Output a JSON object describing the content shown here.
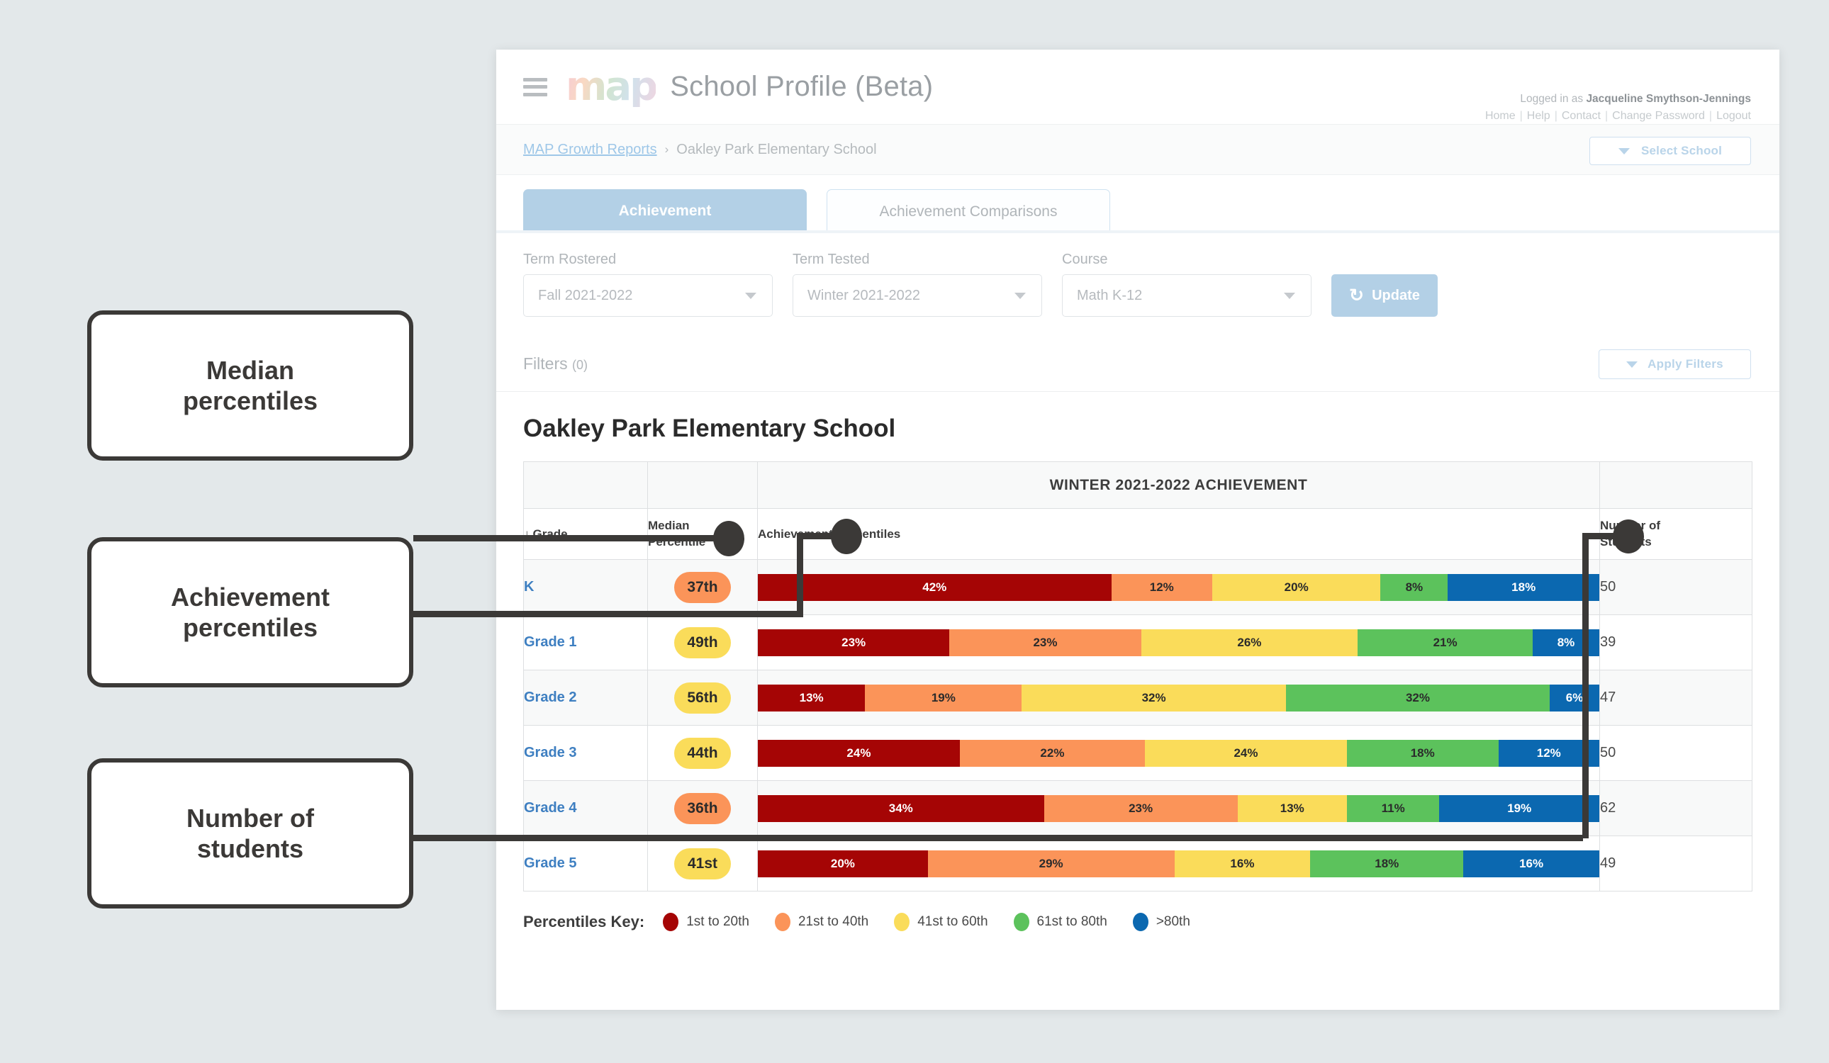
{
  "header": {
    "title": "School Profile (Beta)",
    "logo_text": "map",
    "menu_icon": "hamburger-menu-icon",
    "logged_in_prefix": "Logged in as ",
    "user_name": "Jacqueline Smythson-Jennings",
    "links": [
      "Home",
      "Help",
      "Contact",
      "Change Password",
      "Logout"
    ],
    "link_separator": "|"
  },
  "breadcrumb": {
    "root": "MAP Growth Reports",
    "chevron": "›",
    "current": "Oakley Park Elementary School",
    "select_school_label": "Select School"
  },
  "tabs": [
    {
      "label": "Achievement",
      "active": true
    },
    {
      "label": "Achievement Comparisons",
      "active": false
    }
  ],
  "controls": {
    "term_rostered": {
      "label": "Term Rostered",
      "value": "Fall 2021-2022"
    },
    "term_tested": {
      "label": "Term Tested",
      "value": "Winter 2021-2022"
    },
    "course": {
      "label": "Course",
      "value": "Math K-12"
    },
    "update_label": "Update",
    "update_icon": "refresh-icon"
  },
  "filters": {
    "label": "Filters",
    "count": "(0)",
    "apply_label": "Apply Filters"
  },
  "school_name": "Oakley Park Elementary School",
  "table": {
    "group_header": "WINTER 2021-2022 ACHIEVEMENT",
    "columns": {
      "grade": "Grade",
      "grade_sort_icon": "↓",
      "median_percentile": "Median\nPercentile",
      "median_percentile_line1": "Median",
      "median_percentile_line2": "Percentile",
      "achievement_percentiles": "Achievement Percentiles",
      "number_of_students_line1": "Number of",
      "number_of_students_line2": "Students"
    }
  },
  "legend": {
    "title": "Percentiles Key:",
    "items": [
      {
        "label": "1st to 20th",
        "color": "#A50505"
      },
      {
        "label": "21st to 40th",
        "color": "#FB9459"
      },
      {
        "label": "41st to 60th",
        "color": "#FADC5A"
      },
      {
        "label": "61st to 80th",
        "color": "#5CC25C"
      },
      {
        "label": ">80th",
        "color": "#0B68B0"
      }
    ]
  },
  "callouts": [
    {
      "id": "median",
      "line1": "Median",
      "line2": "percentiles"
    },
    {
      "id": "achiev",
      "line1": "Achievement",
      "line2": "percentiles"
    },
    {
      "id": "nstud",
      "line1": "Number of",
      "line2": "students"
    }
  ],
  "colors": {
    "band1": "#A50505",
    "band2": "#FB9459",
    "band3": "#FADC5A",
    "band4": "#5CC25C",
    "band5": "#0B68B0",
    "pill_orange": "#FB9459",
    "pill_yellow": "#FADC5A",
    "accent_blue": "#B3D0E6",
    "link_blue": "#3E7FC1"
  },
  "chart_data": {
    "type": "bar",
    "title": "WINTER 2021-2022 ACHIEVEMENT",
    "subtitle": "Oakley Park Elementary School",
    "xlabel": "Achievement Percentiles",
    "ylabel": "Grade",
    "stacked": true,
    "percent_total": 100,
    "legend_position": "bottom",
    "grid": false,
    "categories": [
      "K",
      "Grade 1",
      "Grade 2",
      "Grade 3",
      "Grade 4",
      "Grade 5"
    ],
    "series": [
      {
        "name": "1st to 20th",
        "color": "#A50505",
        "values": [
          42,
          23,
          13,
          24,
          34,
          20
        ]
      },
      {
        "name": "21st to 40th",
        "color": "#FB9459",
        "values": [
          12,
          23,
          19,
          22,
          23,
          29
        ]
      },
      {
        "name": "41st to 60th",
        "color": "#FADC5A",
        "values": [
          20,
          26,
          32,
          24,
          13,
          16
        ]
      },
      {
        "name": "61st to 80th",
        "color": "#5CC25C",
        "values": [
          8,
          21,
          32,
          18,
          11,
          18
        ]
      },
      {
        "name": ">80th",
        "color": "#0B68B0",
        "values": [
          18,
          8,
          6,
          12,
          19,
          16
        ]
      }
    ],
    "median_percentiles": [
      "37th",
      "49th",
      "56th",
      "44th",
      "36th",
      "41st"
    ],
    "median_percentile_values": [
      37,
      49,
      56,
      44,
      36,
      41
    ],
    "number_of_students": [
      50,
      39,
      47,
      50,
      62,
      49
    ]
  },
  "rows": [
    {
      "grade": "K",
      "median": "37th",
      "median_color": "#FB9459",
      "students": "50",
      "segments": [
        {
          "label": "42%",
          "value": 42,
          "color": "#A50505",
          "text": "#ffffff"
        },
        {
          "label": "12%",
          "value": 12,
          "color": "#FB9459",
          "text": "#2b2b2b"
        },
        {
          "label": "20%",
          "value": 20,
          "color": "#FADC5A",
          "text": "#2b2b2b"
        },
        {
          "label": "8%",
          "value": 8,
          "color": "#5CC25C",
          "text": "#2b2b2b"
        },
        {
          "label": "18%",
          "value": 18,
          "color": "#0B68B0",
          "text": "#ffffff"
        }
      ]
    },
    {
      "grade": "Grade 1",
      "median": "49th",
      "median_color": "#FADC5A",
      "students": "39",
      "segments": [
        {
          "label": "23%",
          "value": 23,
          "color": "#A50505",
          "text": "#ffffff"
        },
        {
          "label": "23%",
          "value": 23,
          "color": "#FB9459",
          "text": "#2b2b2b"
        },
        {
          "label": "26%",
          "value": 26,
          "color": "#FADC5A",
          "text": "#2b2b2b"
        },
        {
          "label": "21%",
          "value": 21,
          "color": "#5CC25C",
          "text": "#2b2b2b"
        },
        {
          "label": "8%",
          "value": 8,
          "color": "#0B68B0",
          "text": "#ffffff"
        }
      ]
    },
    {
      "grade": "Grade 2",
      "median": "56th",
      "median_color": "#FADC5A",
      "students": "47",
      "segments": [
        {
          "label": "13%",
          "value": 13,
          "color": "#A50505",
          "text": "#ffffff"
        },
        {
          "label": "19%",
          "value": 19,
          "color": "#FB9459",
          "text": "#2b2b2b"
        },
        {
          "label": "32%",
          "value": 32,
          "color": "#FADC5A",
          "text": "#2b2b2b"
        },
        {
          "label": "32%",
          "value": 32,
          "color": "#5CC25C",
          "text": "#2b2b2b"
        },
        {
          "label": "6%",
          "value": 6,
          "color": "#0B68B0",
          "text": "#ffffff"
        }
      ]
    },
    {
      "grade": "Grade 3",
      "median": "44th",
      "median_color": "#FADC5A",
      "students": "50",
      "segments": [
        {
          "label": "24%",
          "value": 24,
          "color": "#A50505",
          "text": "#ffffff"
        },
        {
          "label": "22%",
          "value": 22,
          "color": "#FB9459",
          "text": "#2b2b2b"
        },
        {
          "label": "24%",
          "value": 24,
          "color": "#FADC5A",
          "text": "#2b2b2b"
        },
        {
          "label": "18%",
          "value": 18,
          "color": "#5CC25C",
          "text": "#2b2b2b"
        },
        {
          "label": "12%",
          "value": 12,
          "color": "#0B68B0",
          "text": "#ffffff"
        }
      ]
    },
    {
      "grade": "Grade 4",
      "median": "36th",
      "median_color": "#FB9459",
      "students": "62",
      "segments": [
        {
          "label": "34%",
          "value": 34,
          "color": "#A50505",
          "text": "#ffffff"
        },
        {
          "label": "23%",
          "value": 23,
          "color": "#FB9459",
          "text": "#2b2b2b"
        },
        {
          "label": "13%",
          "value": 13,
          "color": "#FADC5A",
          "text": "#2b2b2b"
        },
        {
          "label": "11%",
          "value": 11,
          "color": "#5CC25C",
          "text": "#2b2b2b"
        },
        {
          "label": "19%",
          "value": 19,
          "color": "#0B68B0",
          "text": "#ffffff"
        }
      ]
    },
    {
      "grade": "Grade 5",
      "median": "41st",
      "median_color": "#FADC5A",
      "students": "49",
      "segments": [
        {
          "label": "20%",
          "value": 20,
          "color": "#A50505",
          "text": "#ffffff"
        },
        {
          "label": "29%",
          "value": 29,
          "color": "#FB9459",
          "text": "#2b2b2b"
        },
        {
          "label": "16%",
          "value": 16,
          "color": "#FADC5A",
          "text": "#2b2b2b"
        },
        {
          "label": "18%",
          "value": 18,
          "color": "#5CC25C",
          "text": "#2b2b2b"
        },
        {
          "label": "16%",
          "value": 16,
          "color": "#0B68B0",
          "text": "#ffffff"
        }
      ]
    }
  ]
}
